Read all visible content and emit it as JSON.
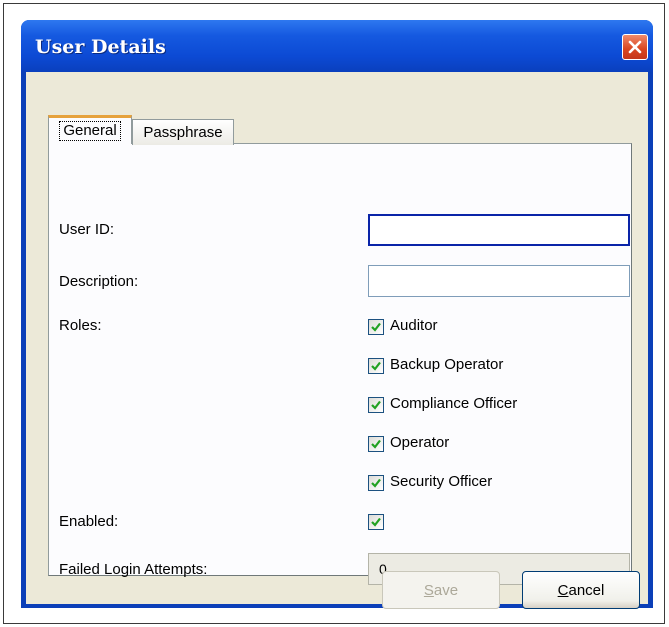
{
  "window": {
    "title": "User Details"
  },
  "tabs": [
    {
      "label": "General",
      "selected": true
    },
    {
      "label": "Passphrase",
      "selected": false
    }
  ],
  "form": {
    "user_id": {
      "label": "User ID:",
      "value": ""
    },
    "description": {
      "label": "Description:",
      "value": ""
    },
    "roles": {
      "label": "Roles:",
      "options": [
        {
          "label": "Auditor",
          "checked": true
        },
        {
          "label": "Backup Operator",
          "checked": true
        },
        {
          "label": "Compliance Officer",
          "checked": true
        },
        {
          "label": "Operator",
          "checked": true
        },
        {
          "label": "Security Officer",
          "checked": true
        }
      ]
    },
    "enabled": {
      "label": "Enabled:",
      "checked": true
    },
    "failed_login_attempts": {
      "label": "Failed Login Attempts:",
      "value": "0"
    }
  },
  "buttons": {
    "save": {
      "mnemonic": "S",
      "rest": "ave",
      "enabled": false
    },
    "cancel": {
      "mnemonic": "C",
      "rest": "ancel",
      "enabled": true
    }
  },
  "colors": {
    "title_bar": "#0c4ad4",
    "window_border": "#0b3fb8",
    "dialog_face": "#ece9d8",
    "close_button": "#d9451f",
    "tab_highlight": "#e6a23c",
    "checkmark": "#21a121"
  },
  "icons": {
    "close": "close-x-icon",
    "check": "check-icon"
  }
}
